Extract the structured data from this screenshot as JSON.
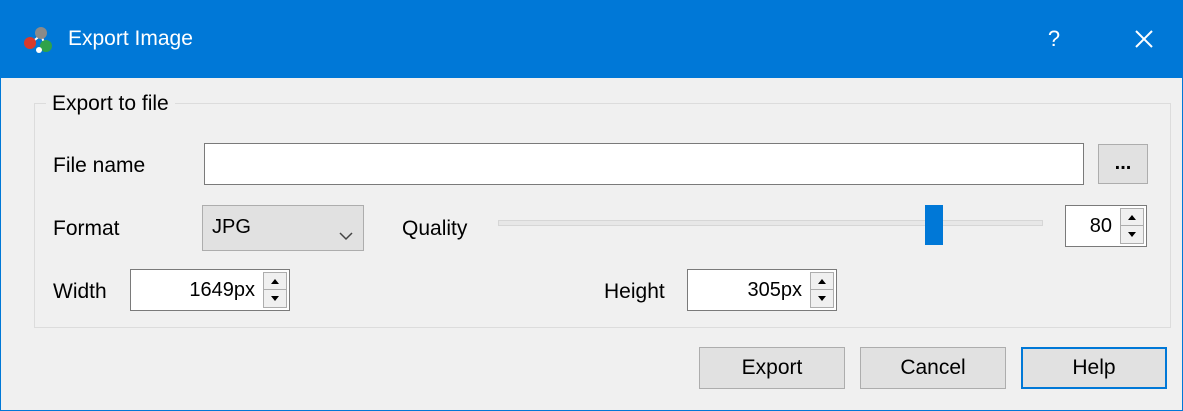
{
  "window": {
    "title": "Export Image",
    "help_glyph": "?",
    "accent_color": "#0078d7"
  },
  "group": {
    "title": "Export to file"
  },
  "file_name": {
    "label": "File name",
    "value": "",
    "browse_label": "..."
  },
  "format": {
    "label": "Format",
    "selected": "JPG"
  },
  "quality": {
    "label": "Quality",
    "value": "80",
    "slider_fraction": 0.8
  },
  "width": {
    "label": "Width",
    "value": "1649px"
  },
  "height": {
    "label": "Height",
    "value": "305px"
  },
  "buttons": {
    "export": "Export",
    "cancel": "Cancel",
    "help": "Help"
  }
}
